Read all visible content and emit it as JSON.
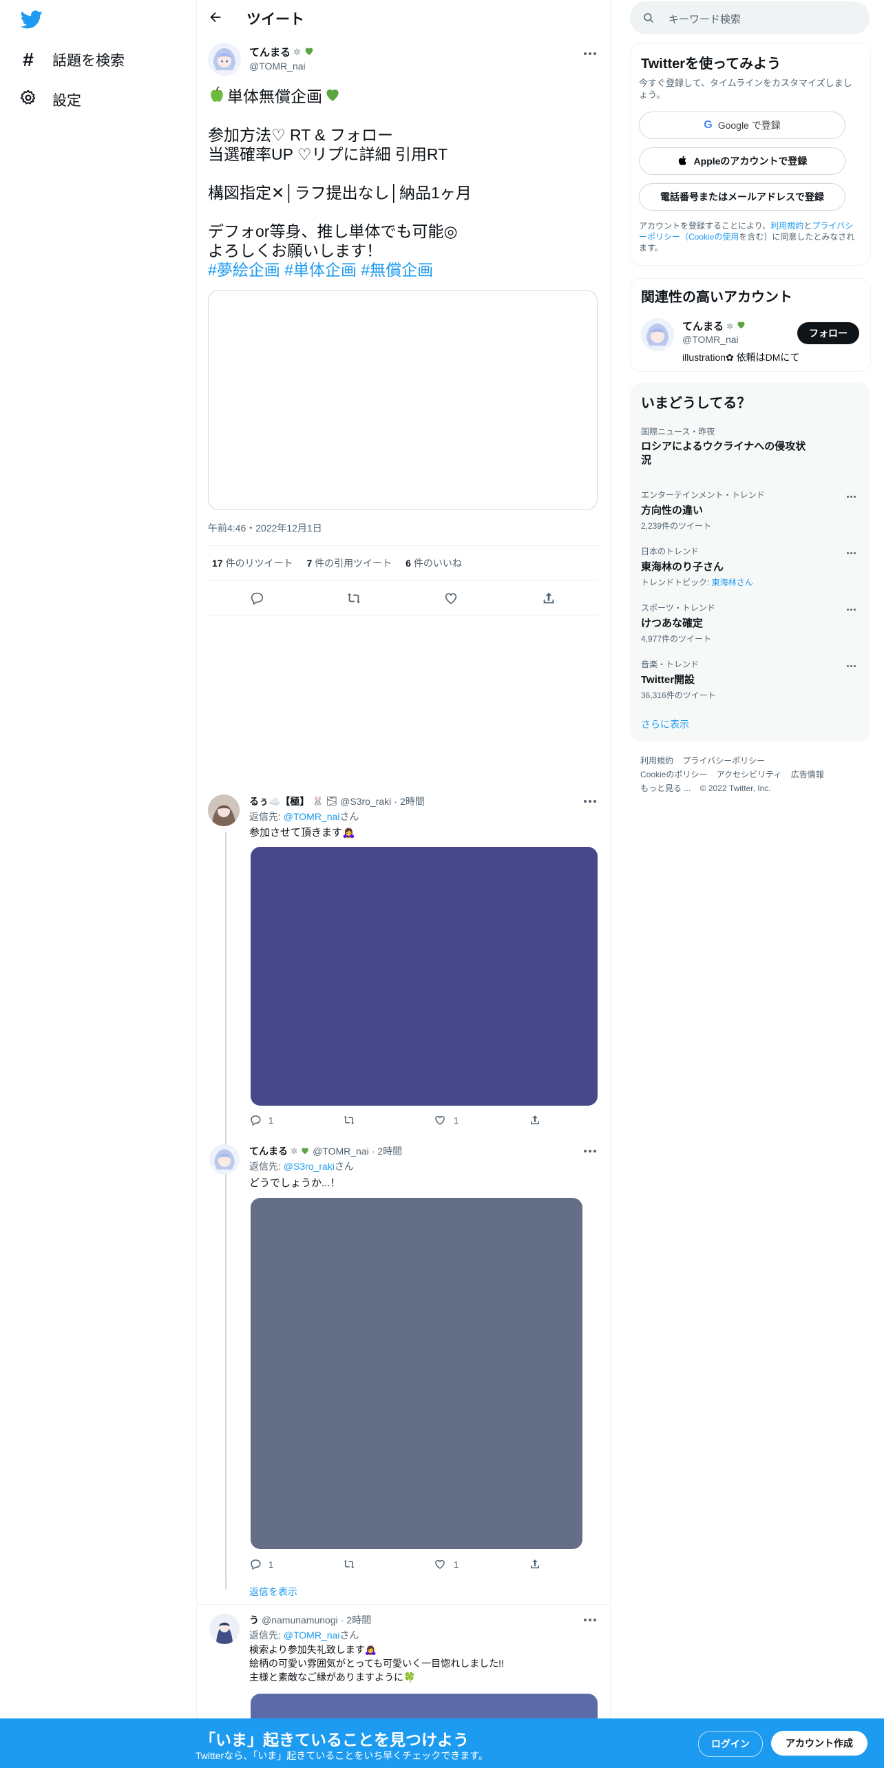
{
  "nav": {
    "explore_label": "話題を検索",
    "settings_label": "設定"
  },
  "header": {
    "title": "ツイート"
  },
  "main_tweet": {
    "author_name": "てんまる",
    "author_handle": "@TOMR_nai",
    "title_line": "単体無償企画",
    "lines": [
      "参加方法♡ RT & フォロー",
      "当選確率UP ♡リプに詳細 引用RT",
      "",
      "構図指定✕│ラフ提出なし│納品1ヶ月",
      "",
      "デフォor等身、推し単体でも可能◎",
      "よろしくお願いします！"
    ],
    "hashtags": [
      "#夢絵企画",
      "#単体企画",
      "#無償企画"
    ],
    "timestamp": "午前4:46・2022年12月1日",
    "stats": {
      "retweets": "17",
      "retweets_label": "件のリツイート",
      "quotes": "7",
      "quotes_label": "件の引用ツイート",
      "likes": "6",
      "likes_label": "件のいいね"
    }
  },
  "replies": [
    {
      "name": "るぅ☁️【極】",
      "handle": "@S3ro_raki",
      "time": "2時間",
      "reply_to_prefix": "返信先: ",
      "reply_to_handle": "@TOMR_nai",
      "reply_to_suffix": "さん",
      "text": "参加させて頂きます🙇‍♀️",
      "image_color": "#47478a",
      "reply_count": "1",
      "like_count": "1"
    },
    {
      "name": "てんまる",
      "handle": "@TOMR_nai",
      "time": "2時間",
      "reply_to_prefix": "返信先: ",
      "reply_to_handle": "@S3ro_raki",
      "reply_to_suffix": "さん",
      "text": "どうでしょうか...！",
      "image_color": "#646e84",
      "reply_count": "1",
      "like_count": "1"
    },
    {
      "name": "う",
      "handle": "@namunamunogi",
      "time": "2時間",
      "reply_to_prefix": "返信先: ",
      "reply_to_handle": "@TOMR_nai",
      "reply_to_suffix": "さん",
      "lines": [
        "検索より参加失礼致します🙇‍♀️",
        "絵柄の可愛い雰囲気がとっても可愛いく一目惚れしました!!",
        "主様と素敵なご縁がありますように🍀"
      ],
      "image_color": "#5c6aa8"
    }
  ],
  "show_replies_label": "返信を表示",
  "sidebar": {
    "search_placeholder": "キーワード検索",
    "signup": {
      "title": "Twitterを使ってみよう",
      "subtitle": "今すぐ登録して、タイムラインをカスタマイズしましょう。",
      "google_label": "Google で登録",
      "apple_label": "Appleのアカウントで登録",
      "phone_label": "電話番号またはメールアドレスで登録",
      "terms_prefix": "アカウントを登録することにより、",
      "terms_link": "利用規約",
      "terms_mid": "と",
      "privacy_link": "プライバシーポリシー（Cookieの使用",
      "terms_suffix": "を含む）に同意したとみなされます。"
    },
    "related": {
      "title": "関連性の高いアカウント",
      "name": "てんまる",
      "handle": "@TOMR_nai",
      "bio": "illustration✿ 依頼はDMにて",
      "follow_label": "フォロー"
    },
    "trends": {
      "title": "いまどうしてる？",
      "items": [
        {
          "context": "国際ニュース・昨夜",
          "topic": "ロシアによるウクライナへの侵攻状況",
          "count": ""
        },
        {
          "context": "エンターテインメント・トレンド",
          "topic": "方向性の違い",
          "count": "2,239件のツイート"
        },
        {
          "context": "日本のトレンド",
          "topic": "東海林のり子さん",
          "count": "トレンドトピック: ",
          "count_link": "東海林さん"
        },
        {
          "context": "スポーツ・トレンド",
          "topic": "けつあな確定",
          "count": "4,977件のツイート"
        },
        {
          "context": "音楽・トレンド",
          "topic": "Twitter開設",
          "count": "36,316件のツイート"
        }
      ],
      "show_more": "さらに表示"
    },
    "footer": {
      "terms": "利用規約",
      "privacy": "プライバシーポリシー",
      "cookie": "Cookieのポリシー",
      "accessibility": "アクセシビリティ",
      "ads": "広告情報",
      "more": "もっと見る ...",
      "copyright": "© 2022 Twitter, Inc."
    }
  },
  "bottom_bar": {
    "title": "「いま」起きていることを見つけよう",
    "subtitle": "Twitterなら、「いま」起きていることをいち早くチェックできます。",
    "login_label": "ログイン",
    "signup_label": "アカウント作成"
  },
  "colors": {
    "accent": "#1d9bf0",
    "text": "#0f1419",
    "secondary": "#536471",
    "green_heart": "#5ba540"
  }
}
